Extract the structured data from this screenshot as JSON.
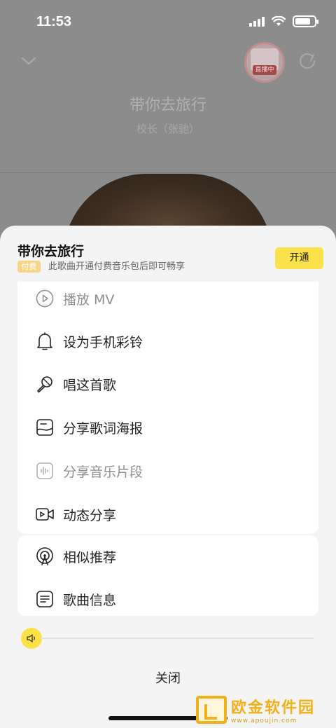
{
  "status_bar": {
    "time": "11:53"
  },
  "player": {
    "song_title": "带你去旅行",
    "artist": "校长（张驰）",
    "live_badge": "直播中"
  },
  "sheet": {
    "title": "带你去旅行",
    "paid_tag": "付费",
    "paid_desc": "此歌曲开通付费音乐包后即可畅享",
    "open_button": "开通",
    "menu": [
      {
        "label": "播放 MV",
        "icon": "play-icon",
        "disabled": true
      },
      {
        "label": "设为手机彩铃",
        "icon": "bell-icon",
        "disabled": false
      },
      {
        "label": "唱这首歌",
        "icon": "microphone-icon",
        "disabled": false
      },
      {
        "label": "分享歌词海报",
        "icon": "poster-icon",
        "disabled": false
      },
      {
        "label": "分享音乐片段",
        "icon": "waveform-icon",
        "disabled": true
      },
      {
        "label": "动态分享",
        "icon": "video-icon",
        "disabled": false
      }
    ],
    "menu2": [
      {
        "label": "相似推荐",
        "icon": "broadcast-icon"
      },
      {
        "label": "歌曲信息",
        "icon": "document-icon"
      }
    ],
    "close_label": "关闭"
  },
  "watermark": {
    "name": "欧金软件园",
    "url": "www.apoujin.com"
  },
  "colors": {
    "accent": "#FCE24A",
    "paid_tag": "#F6D58A",
    "watermark": "#F0B11A"
  }
}
